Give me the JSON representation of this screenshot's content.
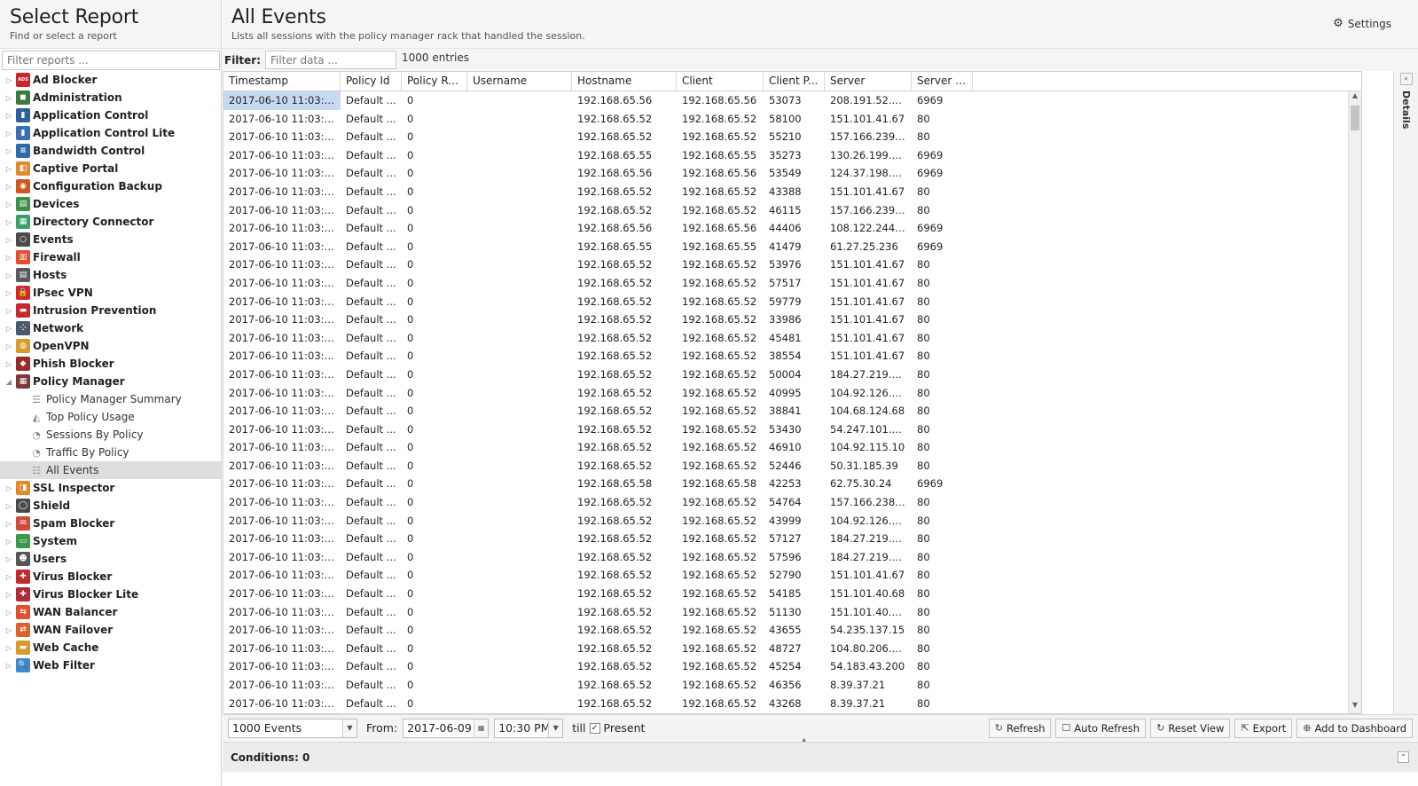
{
  "left": {
    "title": "Select Report",
    "subtitle": "Find or select a report",
    "filter_placeholder": "Filter reports ...",
    "tree": [
      {
        "label": "Ad Blocker",
        "icon": "ad-blocker-icon",
        "color": "#c8272f",
        "glyph": "ADS"
      },
      {
        "label": "Administration",
        "icon": "administration-icon",
        "color": "#3a7a3a",
        "glyph": "◼"
      },
      {
        "label": "Application Control",
        "icon": "application-control-icon",
        "color": "#2f5f9a",
        "glyph": "▮"
      },
      {
        "label": "Application Control Lite",
        "icon": "application-control-lite-icon",
        "color": "#3b6fb5",
        "glyph": "▮"
      },
      {
        "label": "Bandwidth Control",
        "icon": "bandwidth-control-icon",
        "color": "#2c6aa8",
        "glyph": "≡"
      },
      {
        "label": "Captive Portal",
        "icon": "captive-portal-icon",
        "color": "#e08a2c",
        "glyph": "◧"
      },
      {
        "label": "Configuration Backup",
        "icon": "configuration-backup-icon",
        "color": "#d0571d",
        "glyph": "◉"
      },
      {
        "label": "Devices",
        "icon": "devices-icon",
        "color": "#3f8f4a",
        "glyph": "▤"
      },
      {
        "label": "Directory Connector",
        "icon": "directory-connector-icon",
        "color": "#3aa06a",
        "glyph": "▦"
      },
      {
        "label": "Events",
        "icon": "events-icon",
        "color": "#4a4a4a",
        "glyph": "○"
      },
      {
        "label": "Firewall",
        "icon": "firewall-icon",
        "color": "#e0502c",
        "glyph": "▥"
      },
      {
        "label": "Hosts",
        "icon": "hosts-icon",
        "color": "#5a5a5a",
        "glyph": "▤"
      },
      {
        "label": "IPsec VPN",
        "icon": "ipsec-vpn-icon",
        "color": "#d02a2a",
        "glyph": "🔒"
      },
      {
        "label": "Intrusion Prevention",
        "icon": "intrusion-prevention-icon",
        "color": "#c8272f",
        "glyph": "▬"
      },
      {
        "label": "Network",
        "icon": "network-icon",
        "color": "#4a5a6a",
        "glyph": "⁘"
      },
      {
        "label": "OpenVPN",
        "icon": "openvpn-icon",
        "color": "#d89a2a",
        "glyph": "◍"
      },
      {
        "label": "Phish Blocker",
        "icon": "phish-blocker-icon",
        "color": "#9a2a2a",
        "glyph": "◆"
      },
      {
        "label": "Policy Manager",
        "icon": "policy-manager-icon",
        "color": "#7a3a3a",
        "glyph": "▦",
        "expanded": true,
        "children": [
          {
            "label": "Policy Manager Summary",
            "icon": "text-lines-icon",
            "glyph": "☰"
          },
          {
            "label": "Top Policy Usage",
            "icon": "area-chart-icon",
            "glyph": "◭"
          },
          {
            "label": "Sessions By Policy",
            "icon": "pie-chart-icon",
            "glyph": "◔"
          },
          {
            "label": "Traffic By Policy",
            "icon": "pie-chart-icon",
            "glyph": "◔"
          },
          {
            "label": "All Events",
            "icon": "list-icon",
            "glyph": "☷",
            "selected": true
          }
        ]
      },
      {
        "label": "SSL Inspector",
        "icon": "ssl-inspector-icon",
        "color": "#e08a2c",
        "glyph": "◨"
      },
      {
        "label": "Shield",
        "icon": "shield-icon",
        "color": "#4a4a4a",
        "glyph": "◯"
      },
      {
        "label": "Spam Blocker",
        "icon": "spam-blocker-icon",
        "color": "#d04a3a",
        "glyph": "✉"
      },
      {
        "label": "System",
        "icon": "system-icon",
        "color": "#3a9a4a",
        "glyph": "▭"
      },
      {
        "label": "Users",
        "icon": "users-icon",
        "color": "#555555",
        "glyph": "☻"
      },
      {
        "label": "Virus Blocker",
        "icon": "virus-blocker-icon",
        "color": "#c02a2a",
        "glyph": "✚"
      },
      {
        "label": "Virus Blocker Lite",
        "icon": "virus-blocker-lite-icon",
        "color": "#b02a3a",
        "glyph": "✚"
      },
      {
        "label": "WAN Balancer",
        "icon": "wan-balancer-icon",
        "color": "#e0502c",
        "glyph": "⇆"
      },
      {
        "label": "WAN Failover",
        "icon": "wan-failover-icon",
        "color": "#d8642c",
        "glyph": "⇄"
      },
      {
        "label": "Web Cache",
        "icon": "web-cache-icon",
        "color": "#d89a2a",
        "glyph": "▬"
      },
      {
        "label": "Web Filter",
        "icon": "web-filter-icon",
        "color": "#3a8ad0",
        "glyph": "🔍"
      }
    ]
  },
  "main": {
    "title": "All Events",
    "subtitle": "Lists all sessions with the policy manager rack that handled the session.",
    "settings_label": "Settings",
    "filter_label": "Filter:",
    "filter_placeholder": "Filter data ...",
    "entries_count": "1000 entries",
    "details_label": "Details"
  },
  "grid": {
    "columns": [
      "Timestamp",
      "Policy Id",
      "Policy Rul...",
      "Username",
      "Hostname",
      "Client",
      "Client P...",
      "Server",
      "Server P..."
    ],
    "rows": [
      [
        "2017-06-10 11:03:5...",
        "Default ...",
        "0",
        "",
        "192.168.65.56",
        "192.168.65.56",
        "53073",
        "208.191.52.2...",
        "6969"
      ],
      [
        "2017-06-10 11:03:5...",
        "Default ...",
        "0",
        "",
        "192.168.65.52",
        "192.168.65.52",
        "58100",
        "151.101.41.67",
        "80"
      ],
      [
        "2017-06-10 11:03:5...",
        "Default ...",
        "0",
        "",
        "192.168.65.52",
        "192.168.65.52",
        "55210",
        "157.166.239....",
        "80"
      ],
      [
        "2017-06-10 11:03:5...",
        "Default ...",
        "0",
        "",
        "192.168.65.55",
        "192.168.65.55",
        "35273",
        "130.26.199.1...",
        "6969"
      ],
      [
        "2017-06-10 11:03:5...",
        "Default ...",
        "0",
        "",
        "192.168.65.56",
        "192.168.65.56",
        "53549",
        "124.37.198.1...",
        "6969"
      ],
      [
        "2017-06-10 11:03:5...",
        "Default ...",
        "0",
        "",
        "192.168.65.52",
        "192.168.65.52",
        "43388",
        "151.101.41.67",
        "80"
      ],
      [
        "2017-06-10 11:03:5...",
        "Default ...",
        "0",
        "",
        "192.168.65.52",
        "192.168.65.52",
        "46115",
        "157.166.239....",
        "80"
      ],
      [
        "2017-06-10 11:03:5...",
        "Default ...",
        "0",
        "",
        "192.168.65.56",
        "192.168.65.56",
        "44406",
        "108.122.244....",
        "6969"
      ],
      [
        "2017-06-10 11:03:5...",
        "Default ...",
        "0",
        "",
        "192.168.65.55",
        "192.168.65.55",
        "41479",
        "61.27.25.236",
        "6969"
      ],
      [
        "2017-06-10 11:03:5...",
        "Default ...",
        "0",
        "",
        "192.168.65.52",
        "192.168.65.52",
        "53976",
        "151.101.41.67",
        "80"
      ],
      [
        "2017-06-10 11:03:5...",
        "Default ...",
        "0",
        "",
        "192.168.65.52",
        "192.168.65.52",
        "57517",
        "151.101.41.67",
        "80"
      ],
      [
        "2017-06-10 11:03:5...",
        "Default ...",
        "0",
        "",
        "192.168.65.52",
        "192.168.65.52",
        "59779",
        "151.101.41.67",
        "80"
      ],
      [
        "2017-06-10 11:03:5...",
        "Default ...",
        "0",
        "",
        "192.168.65.52",
        "192.168.65.52",
        "33986",
        "151.101.41.67",
        "80"
      ],
      [
        "2017-06-10 11:03:5...",
        "Default ...",
        "0",
        "",
        "192.168.65.52",
        "192.168.65.52",
        "45481",
        "151.101.41.67",
        "80"
      ],
      [
        "2017-06-10 11:03:5...",
        "Default ...",
        "0",
        "",
        "192.168.65.52",
        "192.168.65.52",
        "38554",
        "151.101.41.67",
        "80"
      ],
      [
        "2017-06-10 11:03:5...",
        "Default ...",
        "0",
        "",
        "192.168.65.52",
        "192.168.65.52",
        "50004",
        "184.27.219.2...",
        "80"
      ],
      [
        "2017-06-10 11:03:5...",
        "Default ...",
        "0",
        "",
        "192.168.65.52",
        "192.168.65.52",
        "40995",
        "104.92.126.1...",
        "80"
      ],
      [
        "2017-06-10 11:03:5...",
        "Default ...",
        "0",
        "",
        "192.168.65.52",
        "192.168.65.52",
        "38841",
        "104.68.124.68",
        "80"
      ],
      [
        "2017-06-10 11:03:5...",
        "Default ...",
        "0",
        "",
        "192.168.65.52",
        "192.168.65.52",
        "53430",
        "54.247.101.1...",
        "80"
      ],
      [
        "2017-06-10 11:03:5...",
        "Default ...",
        "0",
        "",
        "192.168.65.52",
        "192.168.65.52",
        "46910",
        "104.92.115.10",
        "80"
      ],
      [
        "2017-06-10 11:03:5...",
        "Default ...",
        "0",
        "",
        "192.168.65.52",
        "192.168.65.52",
        "52446",
        "50.31.185.39",
        "80"
      ],
      [
        "2017-06-10 11:03:5...",
        "Default ...",
        "0",
        "",
        "192.168.65.58",
        "192.168.65.58",
        "42253",
        "62.75.30.24",
        "6969"
      ],
      [
        "2017-06-10 11:03:5...",
        "Default ...",
        "0",
        "",
        "192.168.65.52",
        "192.168.65.52",
        "54764",
        "157.166.238....",
        "80"
      ],
      [
        "2017-06-10 11:03:5...",
        "Default ...",
        "0",
        "",
        "192.168.65.52",
        "192.168.65.52",
        "43999",
        "104.92.126.1...",
        "80"
      ],
      [
        "2017-06-10 11:03:5...",
        "Default ...",
        "0",
        "",
        "192.168.65.52",
        "192.168.65.52",
        "57127",
        "184.27.219.2...",
        "80"
      ],
      [
        "2017-06-10 11:03:5...",
        "Default ...",
        "0",
        "",
        "192.168.65.52",
        "192.168.65.52",
        "57596",
        "184.27.219.2...",
        "80"
      ],
      [
        "2017-06-10 11:03:5...",
        "Default ...",
        "0",
        "",
        "192.168.65.52",
        "192.168.65.52",
        "52790",
        "151.101.41.67",
        "80"
      ],
      [
        "2017-06-10 11:03:5...",
        "Default ...",
        "0",
        "",
        "192.168.65.52",
        "192.168.65.52",
        "54185",
        "151.101.40.68",
        "80"
      ],
      [
        "2017-06-10 11:03:5...",
        "Default ...",
        "0",
        "",
        "192.168.65.52",
        "192.168.65.52",
        "51130",
        "151.101.40.1...",
        "80"
      ],
      [
        "2017-06-10 11:03:5...",
        "Default ...",
        "0",
        "",
        "192.168.65.52",
        "192.168.65.52",
        "43655",
        "54.235.137.15",
        "80"
      ],
      [
        "2017-06-10 11:03:5...",
        "Default ...",
        "0",
        "",
        "192.168.65.52",
        "192.168.65.52",
        "48727",
        "104.80.206.1...",
        "80"
      ],
      [
        "2017-06-10 11:03:5...",
        "Default ...",
        "0",
        "",
        "192.168.65.52",
        "192.168.65.52",
        "45254",
        "54.183.43.200",
        "80"
      ],
      [
        "2017-06-10 11:03:4...",
        "Default ...",
        "0",
        "",
        "192.168.65.52",
        "192.168.65.52",
        "46356",
        "8.39.37.21",
        "80"
      ],
      [
        "2017-06-10 11:03:4...",
        "Default ...",
        "0",
        "",
        "192.168.65.52",
        "192.168.65.52",
        "43268",
        "8.39.37.21",
        "80"
      ]
    ]
  },
  "bottom": {
    "events_select": "1000 Events",
    "from_label": "From:",
    "from_date": "2017-06-09",
    "from_time": "10:30 PM",
    "till_label": "till",
    "present_label": "Present",
    "present_checked": true,
    "refresh_label": "Refresh",
    "auto_refresh_label": "Auto Refresh",
    "reset_view_label": "Reset View",
    "export_label": "Export",
    "add_dashboard_label": "Add to Dashboard"
  },
  "conditions": {
    "label": "Conditions: 0"
  }
}
